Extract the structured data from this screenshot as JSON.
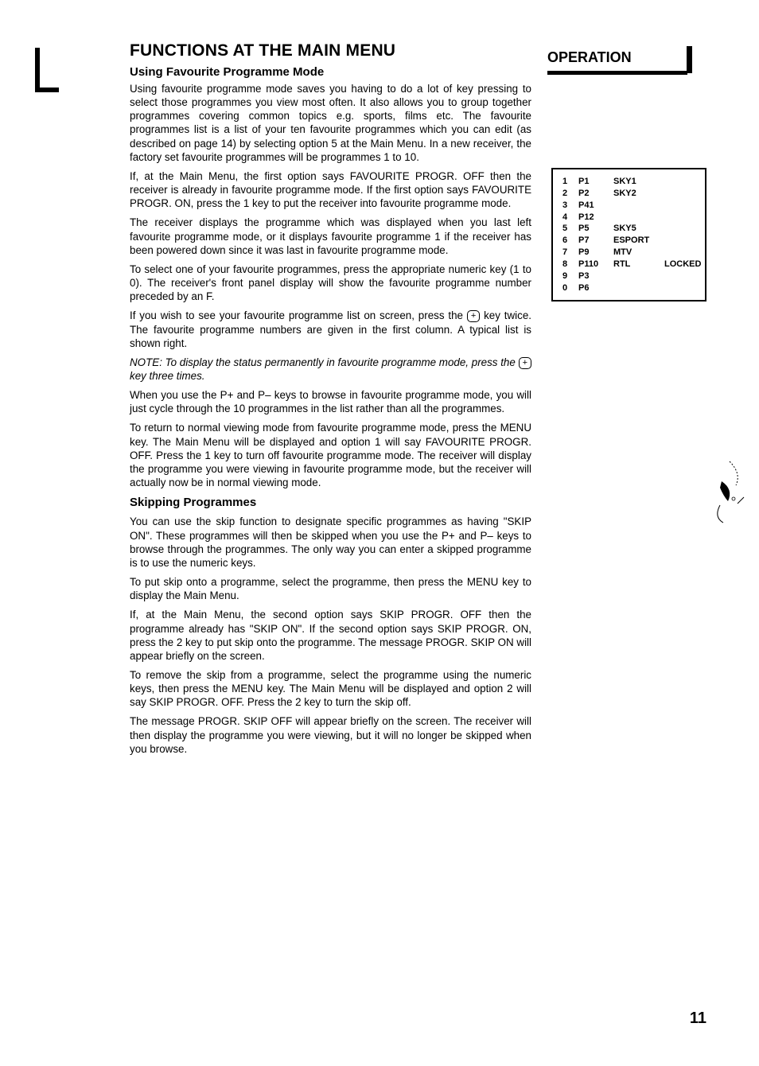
{
  "heading_main": "FUNCTIONS AT THE MAIN MENU",
  "right_header": "OPERATION",
  "subhead1": "Using Favourite Programme Mode",
  "paragraphs_a": [
    "Using favourite programme mode saves you having to do a lot of key pressing to select those programmes you view most often. It also allows you to group together programmes covering common topics e.g. sports, films etc. The favourite programmes list is a list of your ten favourite programmes which you can edit (as described on page 14) by selecting option 5 at the Main Menu. In a new receiver, the factory set favourite programmes will be programmes 1 to 10.",
    "If, at the Main Menu, the first option says FAVOURITE PROGR. OFF then the receiver is already in favourite programme mode. If the first option says FAVOURITE PROGR. ON, press the 1 key to put the receiver into favourite programme mode.",
    "The receiver displays the programme which was displayed when you last left favourite programme mode, or it displays favourite programme 1 if the receiver has been powered down since it was last in favourite programme mode.",
    "To select one of your favourite programmes, press the appropriate numeric key (1 to 0). The receiver's front panel display will show the favourite programme number preceded by an F."
  ],
  "key_paragraph_a": "If you wish to see your favourite programme list on screen, press the ",
  "key_paragraph_b": " key twice. The favourite programme numbers are given in the first column. A typical list is shown right.",
  "note_a": "NOTE: To display the status permanently in favourite programme mode, press the ",
  "note_b": " key three times.",
  "paragraphs_b": [
    "When you use the P+ and P– keys to browse in favourite programme mode, you will just cycle through the 10 programmes in the list rather than all the programmes.",
    "To return to normal viewing mode from favourite programme mode, press the MENU key. The Main Menu will be displayed and option 1 will say FAVOURITE PROGR. OFF. Press the 1 key to turn off favourite programme mode. The receiver will display the programme you were viewing in favourite programme mode, but the receiver will actually now be in normal viewing mode."
  ],
  "subhead2": "Skipping Programmes",
  "paragraphs_c": [
    "You can use the skip function to designate specific programmes as having \"SKIP ON\". These programmes will then be skipped when you use the P+ and P– keys to browse through the programmes. The only way you can enter a skipped programme is to use the numeric keys.",
    "To put skip onto a programme, select the programme, then press the MENU key to display the Main Menu.",
    "If, at the Main Menu, the second option says SKIP PROGR. OFF then the programme already has \"SKIP ON\". If the second option says SKIP PROGR. ON, press the 2 key to put skip onto the programme. The message PROGR. SKIP ON will appear briefly on the screen.",
    "To remove the skip from a programme, select the programme using the numeric keys, then press the MENU key. The Main Menu will be displayed and option 2 will say SKIP PROGR. OFF. Press the 2 key to turn the skip off.",
    "The message PROGR. SKIP OFF will appear briefly on the screen. The receiver will then display the programme you were viewing, but it will no longer be skipped when you browse."
  ],
  "key_glyph": "+",
  "table_rows": [
    {
      "n": "1",
      "p": "P1",
      "c": "SKY1",
      "s": ""
    },
    {
      "n": "2",
      "p": "P2",
      "c": "SKY2",
      "s": ""
    },
    {
      "n": "3",
      "p": "P41",
      "c": "",
      "s": ""
    },
    {
      "n": "4",
      "p": "P12",
      "c": "",
      "s": ""
    },
    {
      "n": "5",
      "p": "P5",
      "c": "SKY5",
      "s": ""
    },
    {
      "n": "6",
      "p": "P7",
      "c": "ESPORT",
      "s": ""
    },
    {
      "n": "7",
      "p": "P9",
      "c": "MTV",
      "s": ""
    },
    {
      "n": "8",
      "p": "P110",
      "c": "RTL",
      "s": "LOCKED"
    },
    {
      "n": "9",
      "p": "P3",
      "c": "",
      "s": ""
    },
    {
      "n": "0",
      "p": "P6",
      "c": "",
      "s": ""
    }
  ],
  "page_number": "11"
}
